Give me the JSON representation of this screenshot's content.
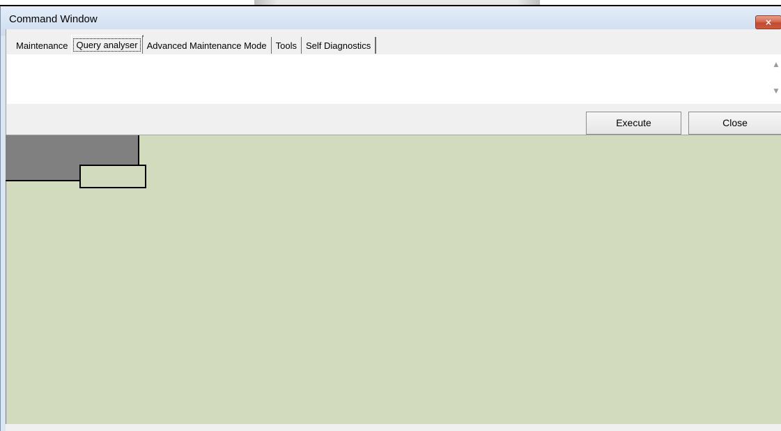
{
  "window": {
    "title": "Command Window",
    "close_icon": "×"
  },
  "tabs": [
    {
      "label": "Maintenance",
      "active": false
    },
    {
      "label": "Query analyser",
      "active": true
    },
    {
      "label": "Advanced Maintenance Mode",
      "active": false
    },
    {
      "label": "Tools",
      "active": false
    },
    {
      "label": "Self Diagnostics",
      "active": false
    }
  ],
  "query": {
    "value": "",
    "scroll_up_icon": "▲",
    "scroll_down_icon": "▼"
  },
  "buttons": {
    "execute_label": "Execute",
    "close_label": "Close"
  },
  "colors": {
    "results_background": "#d3dbbf",
    "grid_header": "#808080",
    "close_button": "#c85a40"
  }
}
